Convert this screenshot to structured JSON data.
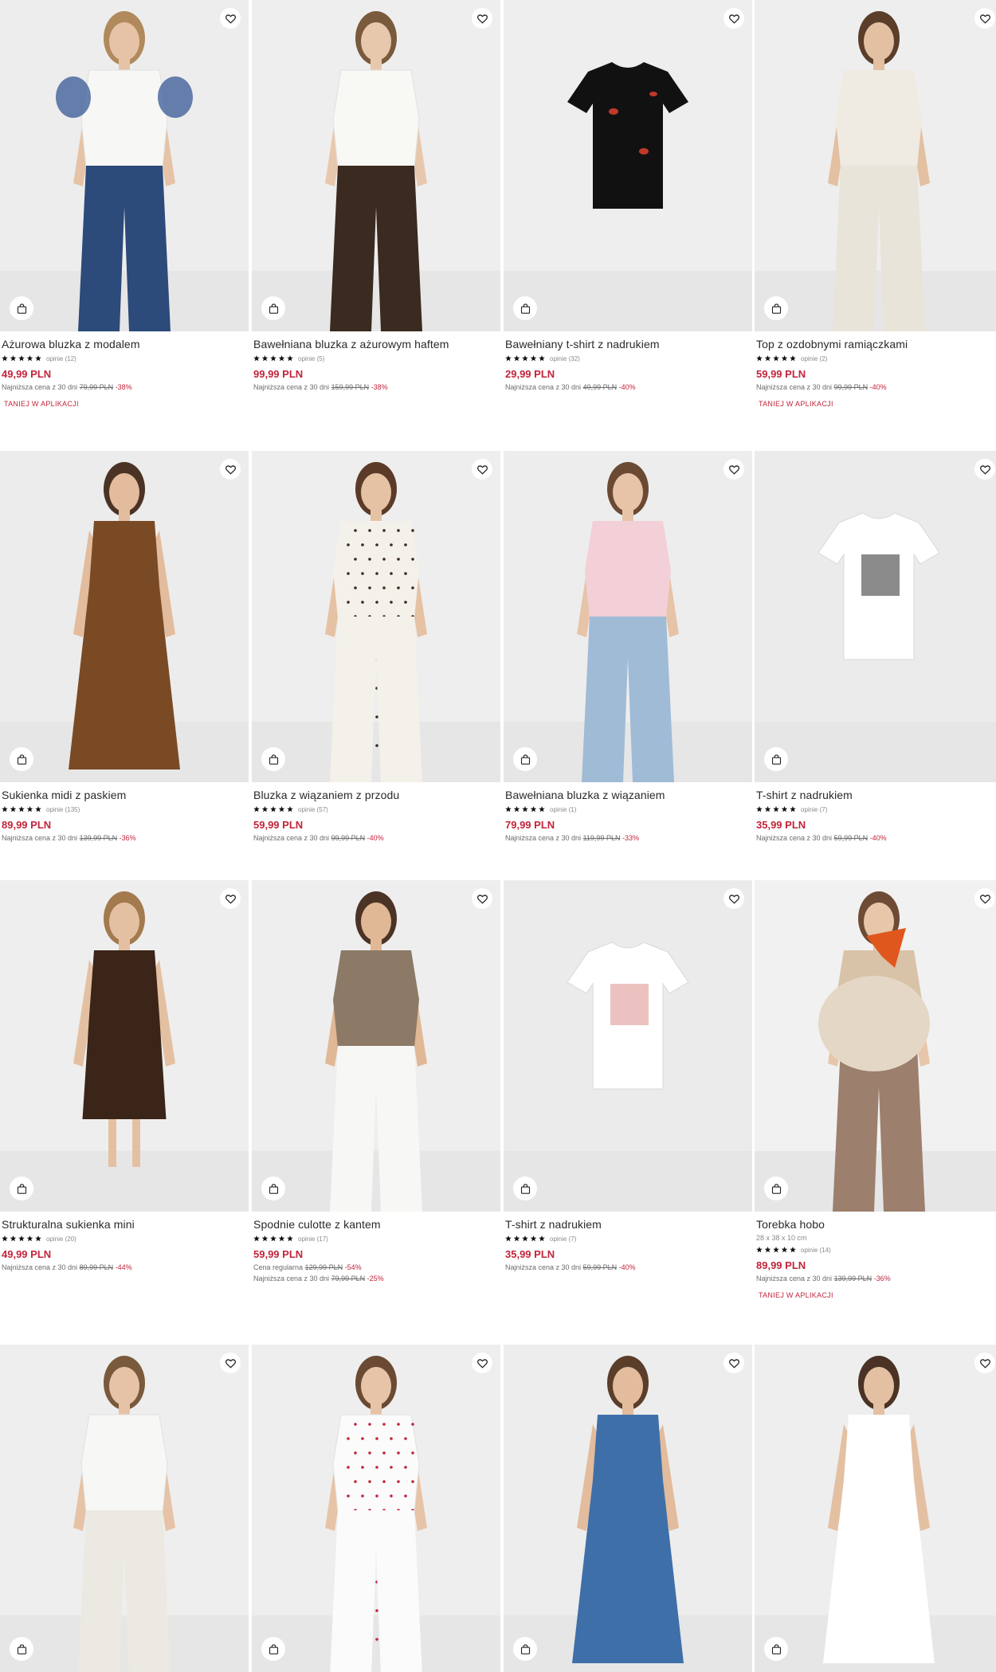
{
  "colors": {
    "price": "#c2243b",
    "text": "#2a2a2a",
    "muted": "#8a8a8a",
    "photo_bg": "#efefef"
  },
  "icons": {
    "wishlist": "heart-outline-icon",
    "cart": "shopping-bag-icon",
    "rating": "star-icon"
  },
  "products": [
    {
      "title": "Ażurowa bluzka z modalem",
      "reviews": "opinie (12)",
      "price": "49,99 PLN",
      "note_prefix": "Najniższa cena z 30 dni",
      "old_price": "79,99 PLN",
      "discount": "-38%",
      "promo": "TANIEJ W APLIKACJI"
    },
    {
      "title": "Bawełniana bluzka z ażurowym haftem",
      "reviews": "opinie (5)",
      "price": "99,99 PLN",
      "note_prefix": "Najniższa cena z 30 dni",
      "old_price": "159,99 PLN",
      "discount": "-38%"
    },
    {
      "title": "Bawełniany t-shirt z nadrukiem",
      "reviews": "opinie (32)",
      "price": "29,99 PLN",
      "note_prefix": "Najniższa cena z 30 dni",
      "old_price": "49,99 PLN",
      "discount": "-40%"
    },
    {
      "title": "Top z ozdobnymi ramiączkami",
      "reviews": "opinie (2)",
      "price": "59,99 PLN",
      "note_prefix": "Najniższa cena z 30 dni",
      "old_price": "99,99 PLN",
      "discount": "-40%",
      "promo": "TANIEJ W APLIKACJI"
    },
    {
      "title": "Sukienka midi z paskiem",
      "reviews": "opinie (135)",
      "price": "89,99 PLN",
      "note_prefix": "Najniższa cena z 30 dni",
      "old_price": "139,99 PLN",
      "discount": "-36%"
    },
    {
      "title": "Bluzka z wiązaniem z przodu",
      "reviews": "opinie (57)",
      "price": "59,99 PLN",
      "note_prefix": "Najniższa cena z 30 dni",
      "old_price": "99,99 PLN",
      "discount": "-40%"
    },
    {
      "title": "Bawełniana bluzka z wiązaniem",
      "reviews": "opinie (1)",
      "price": "79,99 PLN",
      "note_prefix": "Najniższa cena z 30 dni",
      "old_price": "119,99 PLN",
      "discount": "-33%"
    },
    {
      "title": "T-shirt z nadrukiem",
      "reviews": "opinie (7)",
      "price": "35,99 PLN",
      "note_prefix": "Najniższa cena z 30 dni",
      "old_price": "59,99 PLN",
      "discount": "-40%"
    },
    {
      "title": "Strukturalna sukienka mini",
      "reviews": "opinie (20)",
      "price": "49,99 PLN",
      "note_prefix": "Najniższa cena z 30 dni",
      "old_price": "89,99 PLN",
      "discount": "-44%"
    },
    {
      "title": "Spodnie culotte z kantem",
      "reviews": "opinie (17)",
      "price": "59,99 PLN",
      "regular_prefix": "Cena regularna",
      "regular_price": "129,99 PLN",
      "regular_discount": "-54%",
      "note_prefix": "Najniższa cena z 30 dni",
      "old_price": "79,99 PLN",
      "discount": "-25%"
    },
    {
      "title": "T-shirt z nadrukiem",
      "reviews": "opinie (7)",
      "price": "35,99 PLN",
      "note_prefix": "Najniższa cena z 30 dni",
      "old_price": "59,99 PLN",
      "discount": "-40%"
    },
    {
      "title": "Torebka hobo",
      "dims": "28 x 38 x 10 cm",
      "reviews": "opinie (14)",
      "price": "89,99 PLN",
      "note_prefix": "Najniższa cena z 30 dni",
      "old_price": "139,99 PLN",
      "discount": "-36%",
      "promo": "TANIEJ W APLIKACJI"
    },
    {
      "title": ""
    },
    {
      "title": ""
    },
    {
      "title": ""
    },
    {
      "title": ""
    }
  ]
}
